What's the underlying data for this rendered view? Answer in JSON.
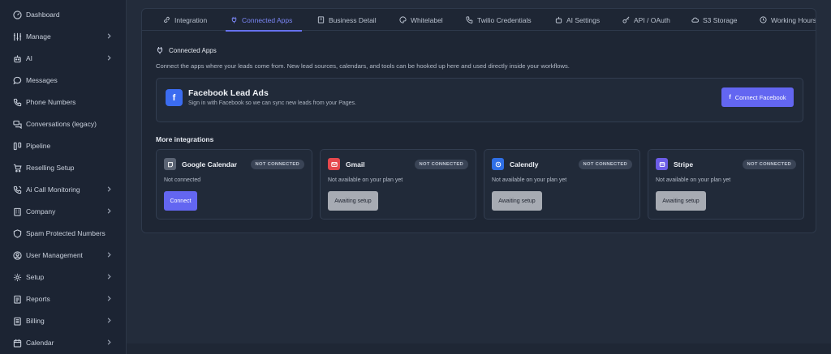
{
  "sidebar": {
    "items": [
      {
        "label": "Dashboard",
        "icon": "dashboard-icon",
        "chevron": false
      },
      {
        "label": "Manage",
        "icon": "sliders-icon",
        "chevron": true
      },
      {
        "label": "AI",
        "icon": "robot-icon",
        "chevron": true
      },
      {
        "label": "Messages",
        "icon": "message-icon",
        "chevron": false
      },
      {
        "label": "Phone Numbers",
        "icon": "phone-icon",
        "chevron": false
      },
      {
        "label": "Conversations (legacy)",
        "icon": "conversations-icon",
        "chevron": false
      },
      {
        "label": "Pipeline",
        "icon": "pipeline-icon",
        "chevron": false
      },
      {
        "label": "Reselling Setup",
        "icon": "cart-icon",
        "chevron": false
      },
      {
        "label": "Ai Call Monitoring",
        "icon": "call-monitor-icon",
        "chevron": true
      },
      {
        "label": "Company",
        "icon": "building-icon",
        "chevron": true
      },
      {
        "label": "Spam Protected Numbers",
        "icon": "shield-icon",
        "chevron": false
      },
      {
        "label": "User Management",
        "icon": "user-icon",
        "chevron": true
      },
      {
        "label": "Setup",
        "icon": "gear-icon",
        "chevron": true
      },
      {
        "label": "Reports",
        "icon": "report-icon",
        "chevron": true
      },
      {
        "label": "Billing",
        "icon": "billing-icon",
        "chevron": true
      },
      {
        "label": "Calendar",
        "icon": "calendar-icon",
        "chevron": true
      }
    ]
  },
  "tabs": [
    {
      "label": "Integration",
      "icon": "link-icon",
      "active": false
    },
    {
      "label": "Connected Apps",
      "icon": "plug-icon",
      "active": true
    },
    {
      "label": "Business Detail",
      "icon": "building-icon",
      "active": false
    },
    {
      "label": "Whitelabel",
      "icon": "palette-icon",
      "active": false
    },
    {
      "label": "Twilio Credentials",
      "icon": "phone-icon",
      "active": false
    },
    {
      "label": "AI Settings",
      "icon": "robot-icon",
      "active": false
    },
    {
      "label": "API / OAuth",
      "icon": "key-icon",
      "active": false
    },
    {
      "label": "S3 Storage",
      "icon": "cloud-icon",
      "active": false
    },
    {
      "label": "Working Hours",
      "icon": "clock-icon",
      "active": false
    }
  ],
  "connected_apps": {
    "title": "Connected Apps",
    "description": "Connect the apps where your leads come from. New lead sources, calendars, and tools can be hooked up here and used directly inside your workflows."
  },
  "facebook": {
    "logo_letter": "f",
    "title": "Facebook Lead Ads",
    "subtitle": "Sign in with Facebook so we can sync new leads from your Pages.",
    "button_label": "Connect Facebook",
    "color": "#3b6cf0"
  },
  "more_integrations": {
    "title": "More integrations",
    "cards": [
      {
        "name": "Google Calendar",
        "badge": "NOT CONNECTED",
        "status": "Not connected",
        "button": "Connect",
        "button_style": "primary",
        "icon": "calendar-icon",
        "icon_color": "#5b6474"
      },
      {
        "name": "Gmail",
        "badge": "NOT CONNECTED",
        "status": "Not available on your plan yet",
        "button": "Awaiting setup",
        "button_style": "disabled",
        "icon": "mail-icon",
        "icon_color": "#e5484d"
      },
      {
        "name": "Calendly",
        "badge": "NOT CONNECTED",
        "status": "Not available on your plan yet",
        "button": "Awaiting setup",
        "button_style": "disabled",
        "icon": "clock-icon",
        "icon_color": "#2f6fe6"
      },
      {
        "name": "Stripe",
        "badge": "NOT CONNECTED",
        "status": "Not available on your plan yet",
        "button": "Awaiting setup",
        "button_style": "disabled",
        "icon": "card-icon",
        "icon_color": "#6c5ce7"
      }
    ]
  }
}
